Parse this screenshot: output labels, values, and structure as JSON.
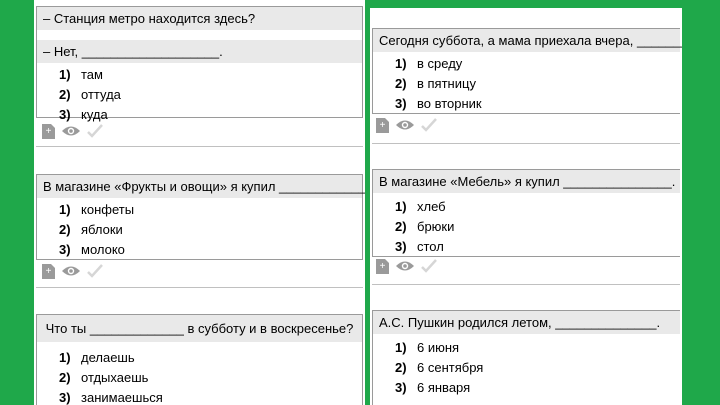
{
  "left": {
    "q1": {
      "line1": "– Станция метро находится здесь?",
      "line2": "– Нет, ___________________.",
      "options": [
        {
          "num": "1)",
          "text": "там"
        },
        {
          "num": "2)",
          "text": "оттуда"
        },
        {
          "num": "3)",
          "text": "куда"
        }
      ]
    },
    "q2": {
      "text": "В магазине «Фрукты и овощи» я купил _____________.",
      "options": [
        {
          "num": "1)",
          "text": "конфеты"
        },
        {
          "num": "2)",
          "text": "яблоки"
        },
        {
          "num": "3)",
          "text": "молоко"
        }
      ]
    },
    "q3": {
      "text": "Что ты _____________ в субботу и в воскресенье?",
      "options": [
        {
          "num": "1)",
          "text": "делаешь"
        },
        {
          "num": "2)",
          "text": "отдыхаешь"
        },
        {
          "num": "3)",
          "text": "занимаешься"
        }
      ]
    }
  },
  "right": {
    "q1": {
      "text": "Сегодня суббота, а мама приехала вчера, ___________",
      "options": [
        {
          "num": "1)",
          "text": "в среду"
        },
        {
          "num": "2)",
          "text": "в пятницу"
        },
        {
          "num": "3)",
          "text": "во вторник"
        }
      ]
    },
    "q2": {
      "text": "В магазине «Мебель» я купил _______________.",
      "options": [
        {
          "num": "1)",
          "text": "хлеб"
        },
        {
          "num": "2)",
          "text": "брюки"
        },
        {
          "num": "3)",
          "text": "стол"
        }
      ]
    },
    "q3": {
      "text": "А.С. Пушкин родился летом, ______________.",
      "options": [
        {
          "num": "1)",
          "text": "6 июня"
        },
        {
          "num": "2)",
          "text": "6 сентября"
        },
        {
          "num": "3)",
          "text": "6 января"
        }
      ]
    }
  },
  "icons": {
    "add": "add-note-icon",
    "view": "eye-icon",
    "check": "checkmark-icon",
    "add_glyph": "+"
  },
  "colors": {
    "background": "#1fa84a",
    "question_bg": "#e9e9e9",
    "icon_gray": "#9a9a9a"
  }
}
